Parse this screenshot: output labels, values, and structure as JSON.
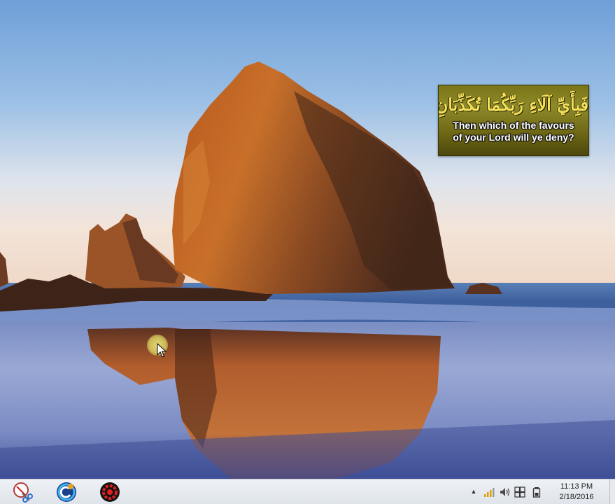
{
  "widget": {
    "arabic_text": "فَبِأَيِّ آلَاءِ رَبِّكُمَا تُكَذِّبَانِ",
    "english_line1": "Then which of the favours",
    "english_line2": "of your Lord will ye deny?",
    "background_color": "#7e7a1e",
    "arabic_color": "#f5e25a"
  },
  "taskbar": {
    "pinned": [
      {
        "name": "snipping-tool-icon"
      },
      {
        "name": "cyberlink-app-icon"
      },
      {
        "name": "red-gear-app-icon"
      }
    ],
    "tray": {
      "show_hidden_label": "▲",
      "icons": [
        "network-bars-icon",
        "volume-icon",
        "windows-flag-icon",
        "battery-icon"
      ]
    },
    "clock": {
      "time": "11:13 PM",
      "date": "2/18/2016"
    }
  },
  "icons": {
    "cursor": "arrow-cursor-icon",
    "cursor_highlight_color": "#e8dc78"
  }
}
